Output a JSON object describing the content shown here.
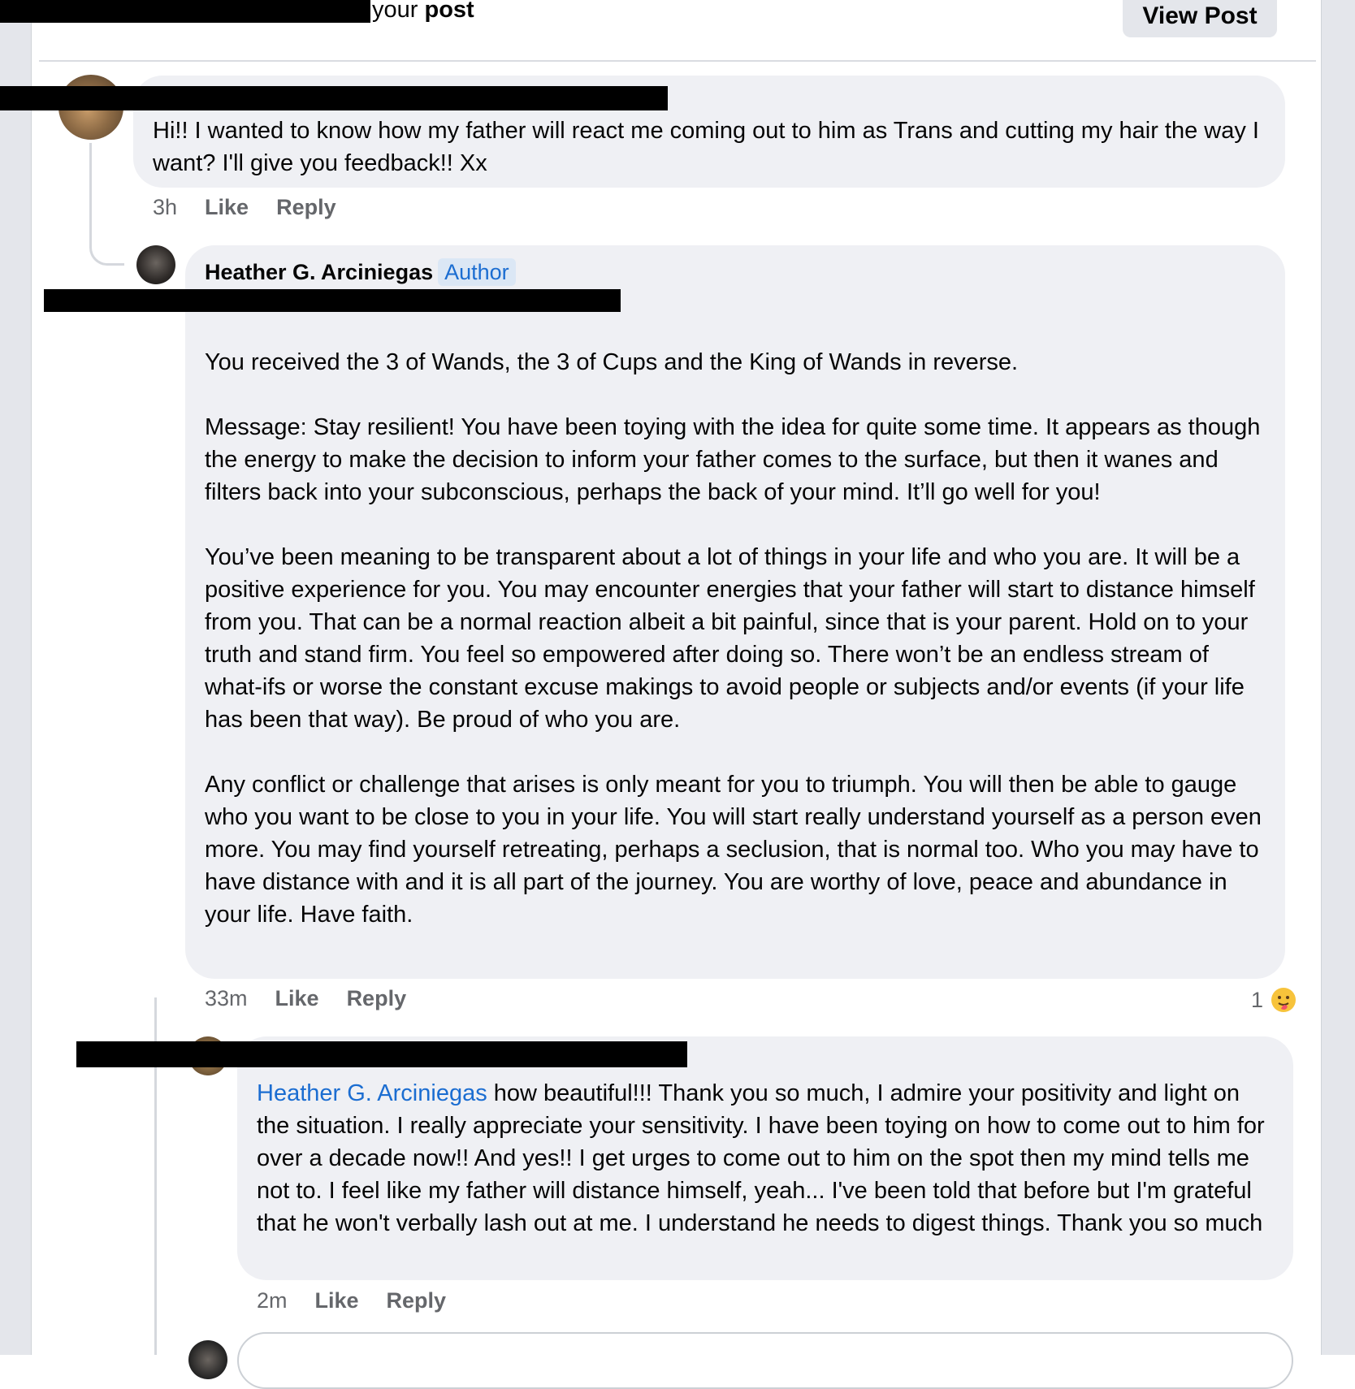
{
  "header": {
    "text_prefix": "your",
    "text_strong": "post",
    "view_post_label": "View Post"
  },
  "comment1": {
    "text": "Hi!! I wanted to know how my father will react me coming out to him as Trans and cutting my hair the way I want? I'll give you feedback!! Xx",
    "time": "3h",
    "like_label": "Like",
    "reply_label": "Reply"
  },
  "comment2": {
    "author_name": "Heather G. Arciniegas",
    "author_badge": "Author",
    "text": "You received the 3 of Wands, the 3 of Cups and the King of Wands in reverse.\n\nMessage: Stay resilient! You have been toying with the idea for quite some time. It appears as though the energy to make the decision to inform your father comes to the surface, but then it wanes and filters back into your subconscious, perhaps the back of your mind. It’ll go well for you!\n\nYou’ve been meaning to be transparent about a lot of things in your life and who you are. It will be a positive experience for you. You may encounter energies that your father will start to distance himself from you. That can be a normal reaction albeit a bit painful, since that is your parent. Hold on to your truth and stand firm. You feel so empowered after doing so. There won’t be an endless stream of what-ifs or worse the constant excuse makings to avoid people or subjects and/or events (if your life has been that way). Be proud of who you are.\n\nAny conflict or challenge that arises is only meant for you to triumph. You will then be able to gauge who you want to be close to you in your life. You will start really understand yourself as a person even more. You may find yourself retreating, perhaps a seclusion, that is normal too. Who you may have to have distance with and it is all part of the journey. You are worthy of love, peace and abundance in your life. Have faith.",
    "time": "33m",
    "like_label": "Like",
    "reply_label": "Reply",
    "reaction_count": "1",
    "reaction_icon": "hug-emoji-icon"
  },
  "comment3": {
    "mention": "Heather G. Arciniegas",
    "text": " how beautiful!!! Thank you so much, I admire your positivity and light on the situation. I really appreciate your sensitivity. I have been toying on how to come out to him for over a decade now!! And yes!! I get urges to come out to him on the spot then my mind tells me not to. I feel like my father will distance himself, yeah... I've been told that before but I'm grateful that he won't verbally lash out at me. I understand he needs to digest things. Thank you so much",
    "time": "2m",
    "like_label": "Like",
    "reply_label": "Reply"
  },
  "colors": {
    "link": "#1b6dd1",
    "bubble": "#eff0f4",
    "meta": "#65676b"
  }
}
